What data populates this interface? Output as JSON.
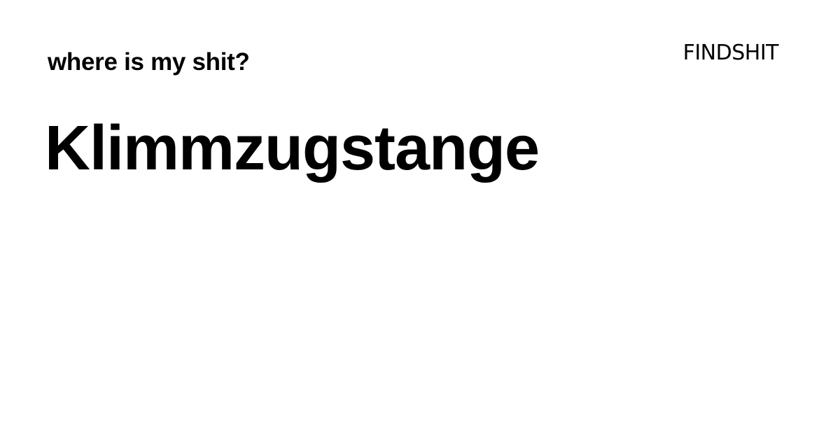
{
  "header": {
    "tagline": "where is my shit?",
    "logo": "FINDSHIT"
  },
  "main": {
    "title": "Klimmzugstange"
  },
  "colors": {
    "background": "#ffffff",
    "text": "#000000"
  }
}
